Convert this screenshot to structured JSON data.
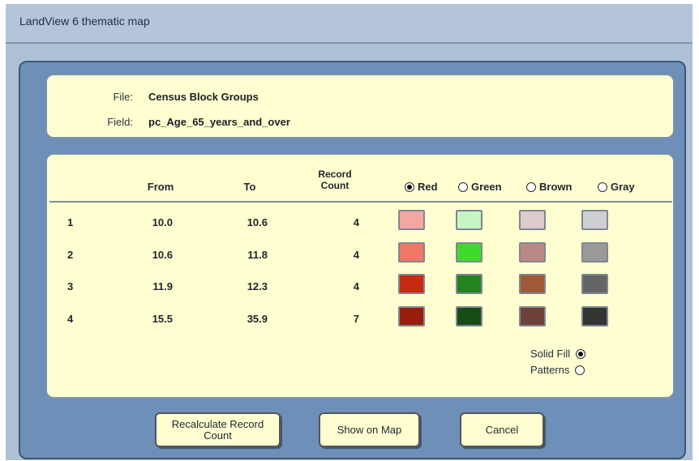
{
  "window": {
    "title": "LandView 6 thematic map"
  },
  "info": {
    "file_label": "File:",
    "file_value": "Census Block Groups",
    "field_label": "Field:",
    "field_value": "pc_Age_65_years_and_over"
  },
  "grid": {
    "headers": {
      "from": "From",
      "to": "To",
      "record_count_line1": "Record",
      "record_count_line2": "Count"
    },
    "color_options": [
      {
        "label": "Red",
        "selected": true
      },
      {
        "label": "Green",
        "selected": false
      },
      {
        "label": "Brown",
        "selected": false
      },
      {
        "label": "Gray",
        "selected": false
      }
    ],
    "rows": [
      {
        "index": "1",
        "from": "10.0",
        "to": "10.6",
        "count": "4",
        "colors": [
          "#f4a6a3",
          "#c7f4c4",
          "#decbcb",
          "#cfcfd3"
        ]
      },
      {
        "index": "2",
        "from": "10.6",
        "to": "11.8",
        "count": "4",
        "colors": [
          "#ef7867",
          "#3fda2b",
          "#bb8985",
          "#9a9a9a"
        ]
      },
      {
        "index": "3",
        "from": "11.9",
        "to": "12.3",
        "count": "4",
        "colors": [
          "#c72a10",
          "#238321",
          "#9f5937",
          "#656565"
        ]
      },
      {
        "index": "4",
        "from": "15.5",
        "to": "35.9",
        "count": "7",
        "colors": [
          "#971e0b",
          "#154d14",
          "#6e413b",
          "#343434"
        ]
      }
    ],
    "fill_options": {
      "solid_fill": {
        "label": "Solid Fill",
        "selected": true
      },
      "patterns": {
        "label": "Patterns",
        "selected": false
      }
    }
  },
  "buttons": {
    "recalculate_line1": "Recalculate Record",
    "recalculate_line2": "Count",
    "show_on_map": "Show on Map",
    "cancel": "Cancel"
  }
}
